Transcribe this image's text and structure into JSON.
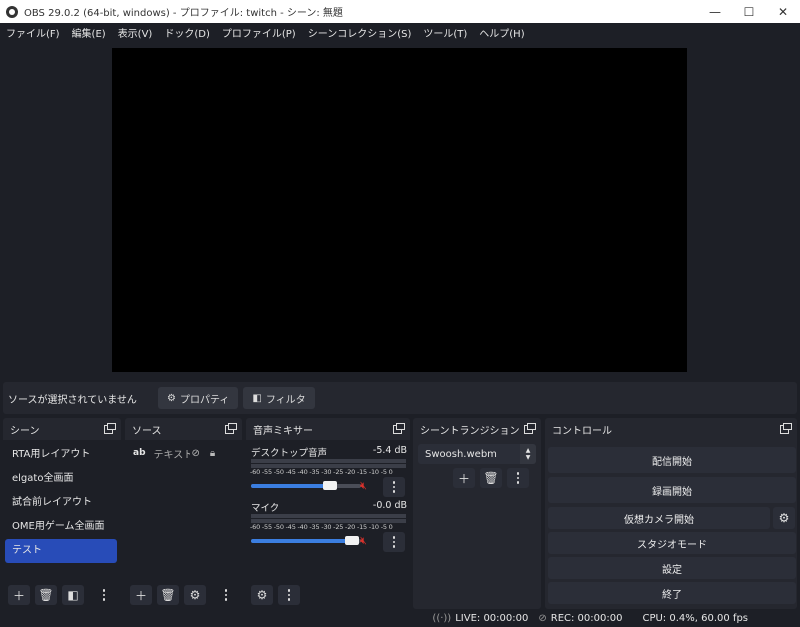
{
  "window": {
    "title": "OBS 29.0.2 (64-bit, windows) - プロファイル: twitch - シーン: 無題",
    "minimize": "—",
    "maximize": "☐",
    "close": "✕"
  },
  "menu": [
    "ファイル(F)",
    "編集(E)",
    "表示(V)",
    "ドック(D)",
    "プロファイル(P)",
    "シーンコレクション(S)",
    "ツール(T)",
    "ヘルプ(H)"
  ],
  "context_bar": {
    "no_source": "ソースが選択されていません",
    "properties": "プロパティ",
    "filters": "フィルタ"
  },
  "scenes": {
    "title": "シーン",
    "items": [
      "RTA用レイアウト",
      "elgato全画面",
      "試合前レイアウト",
      "OME用ゲーム全画面",
      "テスト"
    ],
    "selected_index": 4
  },
  "sources": {
    "title": "ソース",
    "items": [
      {
        "type": "ab",
        "name": "テキスト (GI"
      }
    ]
  },
  "mixer": {
    "title": "音声ミキサー",
    "scale": "-60 -55 -50 -45 -40 -35 -30 -25 -20 -15 -10 -5  0",
    "channels": [
      {
        "name": "デスクトップ音声",
        "db": "-5.4 dB",
        "volume": 0.72,
        "muted": true
      },
      {
        "name": "マイク",
        "db": "-0.0 dB",
        "volume": 0.92,
        "muted": true
      }
    ]
  },
  "transitions": {
    "title": "シーントランジション",
    "selected": "Swoosh.webm"
  },
  "controls": {
    "title": "コントロール",
    "start_streaming": "配信開始",
    "start_recording": "録画開始",
    "start_virtual_camera": "仮想カメラ開始",
    "studio_mode": "スタジオモード",
    "settings": "設定",
    "exit": "終了"
  },
  "status": {
    "live": "LIVE: 00:00:00",
    "rec": "REC: 00:00:00",
    "cpu": "CPU: 0.4%, 60.00 fps"
  }
}
